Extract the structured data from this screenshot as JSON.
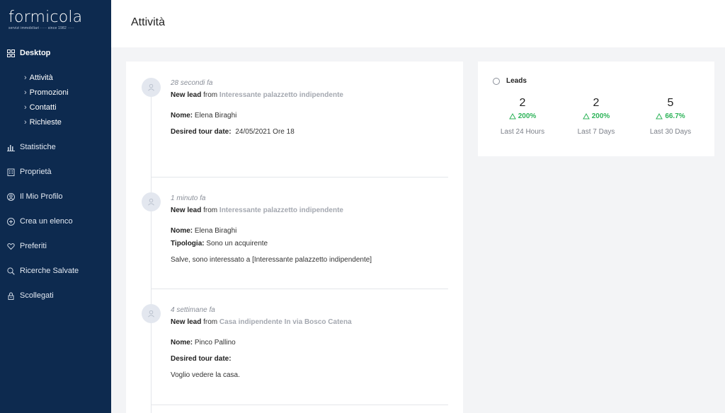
{
  "brand": {
    "name": "formicola",
    "tagline": "servizi immobiliari ····· since 1982 ·····"
  },
  "sidebar": {
    "items": [
      {
        "label": "Desktop",
        "icon": "dashboard-icon"
      },
      {
        "label": "Statistiche",
        "icon": "bar-chart-icon"
      },
      {
        "label": "Proprietà",
        "icon": "building-icon"
      },
      {
        "label": "Il Mio Profilo",
        "icon": "user-circle-icon"
      },
      {
        "label": "Crea un elenco",
        "icon": "plus-circle-icon"
      },
      {
        "label": "Preferiti",
        "icon": "heart-icon"
      },
      {
        "label": "Ricerche Salvate",
        "icon": "search-icon"
      },
      {
        "label": "Scollegati",
        "icon": "lock-icon"
      }
    ],
    "subitems": [
      "Attività",
      "Promozioni",
      "Contatti",
      "Richieste"
    ]
  },
  "header": {
    "title": "Attività"
  },
  "activity": {
    "entries": [
      {
        "time": "28 secondi fa",
        "prefix": "New lead",
        "from": "from",
        "property": "Interessante palazzetto indipendente",
        "name_label": "Nome:",
        "name_value": "Elena Biraghi",
        "tour_label": "Desired tour date:",
        "tour_value": "24/05/2021 Ore 18"
      },
      {
        "time": "1 minuto fa",
        "prefix": "New lead",
        "from": "from",
        "property": "Interessante palazzetto indipendente",
        "name_label": "Nome:",
        "name_value": "Elena Biraghi",
        "type_label": "Tipologia:",
        "type_value": "Sono un acquirente",
        "message": "Salve, sono interessato a [Interessante palazzetto indipendente]"
      },
      {
        "time": "4 settimane fa",
        "prefix": "New lead",
        "from": "from",
        "property": "Casa indipendente In via Bosco Catena",
        "name_label": "Nome:",
        "name_value": "Pinco Pallino",
        "tour_label": "Desired tour date:",
        "message": "Voglio vedere la casa."
      }
    ]
  },
  "leads": {
    "title": "Leads",
    "accent_color": "#2fb45a",
    "stats": [
      {
        "value": "2",
        "change": "200%",
        "label": "Last 24 Hours"
      },
      {
        "value": "2",
        "change": "200%",
        "label": "Last 7 Days"
      },
      {
        "value": "5",
        "change": "66.7%",
        "label": "Last 30 Days"
      }
    ]
  }
}
